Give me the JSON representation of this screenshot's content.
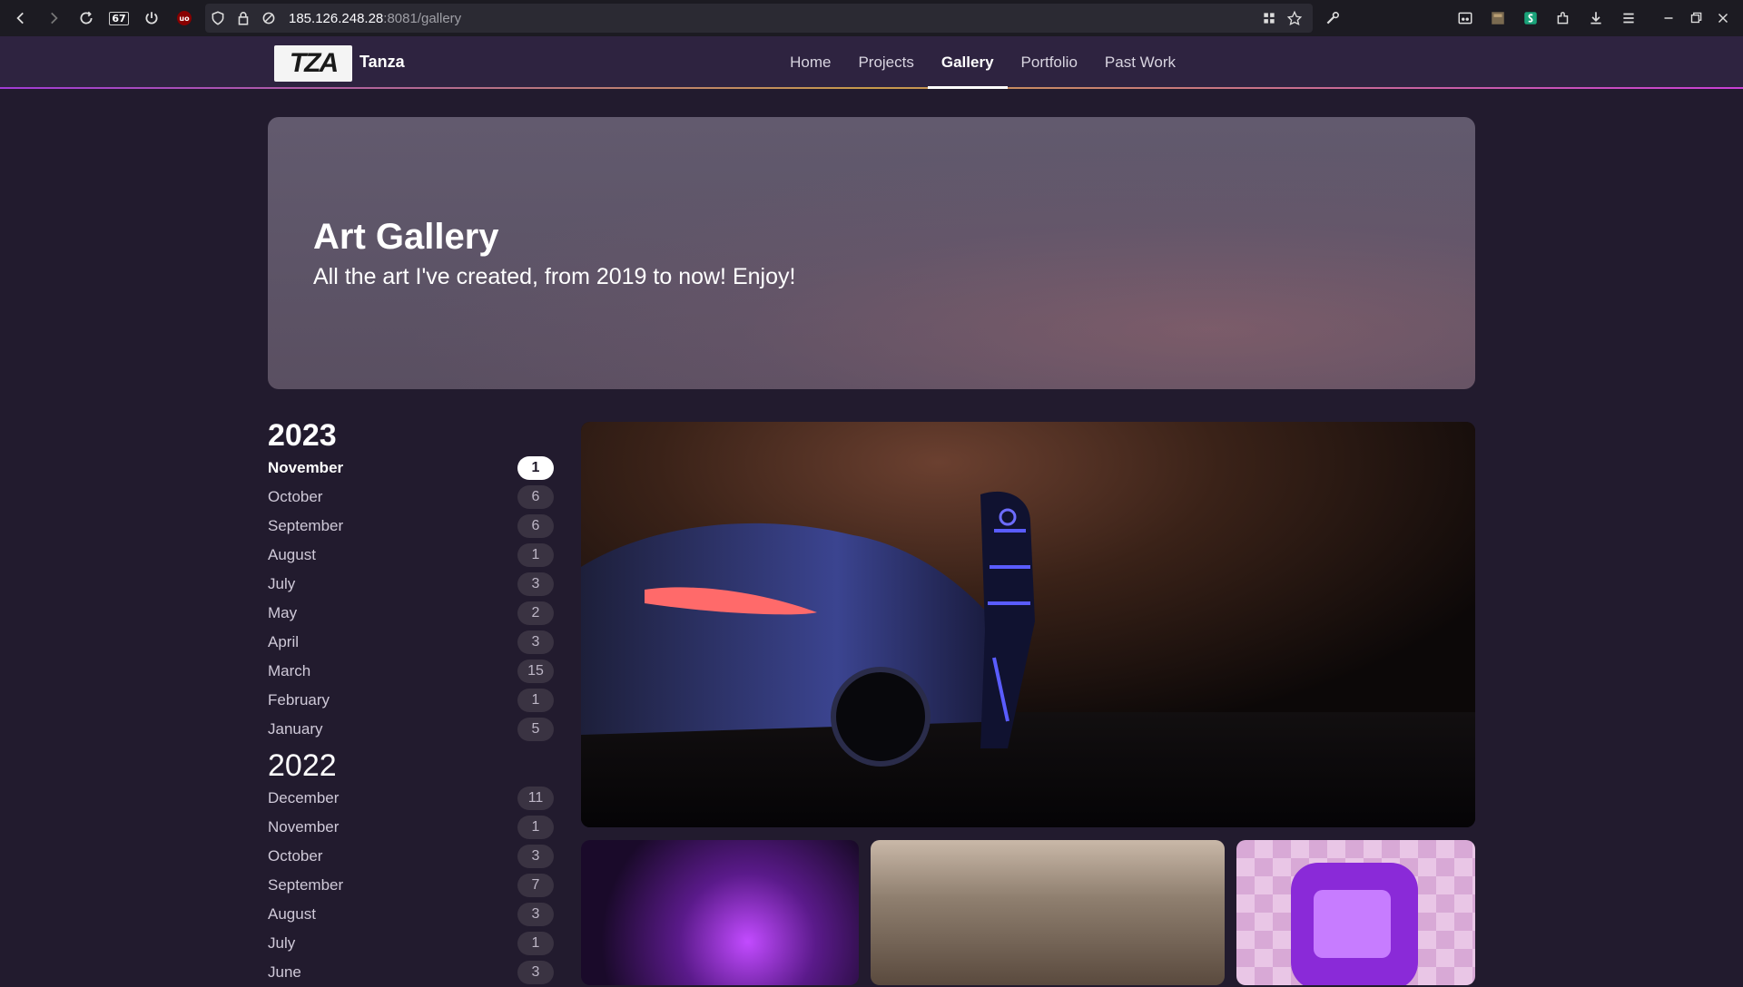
{
  "browser": {
    "url_host": "185.126.248.28",
    "url_rest": ":8081/gallery",
    "badge": "67"
  },
  "site": {
    "logo_text": "TZA",
    "brand": "Tanza",
    "nav": [
      {
        "label": "Home",
        "active": false
      },
      {
        "label": "Projects",
        "active": false
      },
      {
        "label": "Gallery",
        "active": true
      },
      {
        "label": "Portfolio",
        "active": false
      },
      {
        "label": "Past Work",
        "active": false
      }
    ]
  },
  "hero": {
    "title": "Art Gallery",
    "subtitle": "All the art I've created, from 2019 to now! Enjoy!"
  },
  "archive": [
    {
      "year": "2023",
      "months": [
        {
          "name": "November",
          "count": "1"
        },
        {
          "name": "October",
          "count": "6"
        },
        {
          "name": "September",
          "count": "6"
        },
        {
          "name": "August",
          "count": "1"
        },
        {
          "name": "July",
          "count": "3"
        },
        {
          "name": "May",
          "count": "2"
        },
        {
          "name": "April",
          "count": "3"
        },
        {
          "name": "March",
          "count": "15"
        },
        {
          "name": "February",
          "count": "1"
        },
        {
          "name": "January",
          "count": "5"
        }
      ]
    },
    {
      "year": "2022",
      "months": [
        {
          "name": "December",
          "count": "11"
        },
        {
          "name": "November",
          "count": "1"
        },
        {
          "name": "October",
          "count": "3"
        },
        {
          "name": "September",
          "count": "7"
        },
        {
          "name": "August",
          "count": "3"
        },
        {
          "name": "July",
          "count": "1"
        },
        {
          "name": "June",
          "count": "3"
        }
      ]
    }
  ],
  "colors": {
    "background": "#221b2e",
    "header": "#2e2340",
    "accent": "#a13bd6"
  }
}
